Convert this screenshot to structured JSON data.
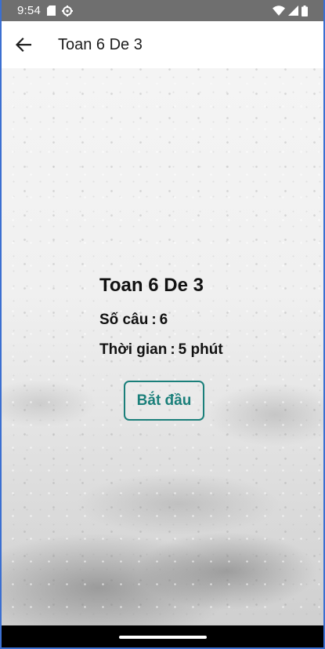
{
  "status_bar": {
    "time": "9:54",
    "icons": [
      "sd-card-icon",
      "gear-icon",
      "wifi-icon",
      "signal-icon",
      "battery-icon"
    ]
  },
  "app_bar": {
    "back_icon": "arrow-left-icon",
    "title": "Toan 6 De 3"
  },
  "quiz": {
    "title": "Toan 6 De 3",
    "question_count_label": "Số câu",
    "question_count": "6",
    "time_label": "Thời gian",
    "time_value": "5 phút",
    "separator": ":"
  },
  "actions": {
    "start_label": "Bắt đầu"
  },
  "colors": {
    "status_bar": "#6f6f6f",
    "accent": "#1a7f7a",
    "frame_border": "#3b6fd1"
  }
}
